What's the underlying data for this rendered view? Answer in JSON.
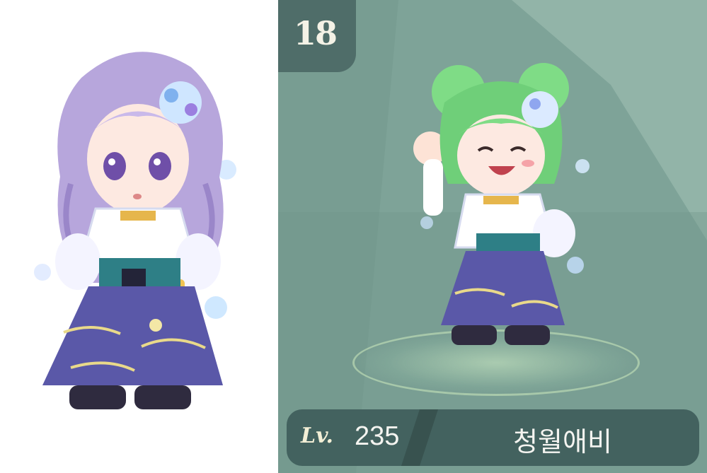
{
  "ranking_card": {
    "rank": "18",
    "level_label": "Lv.",
    "level_value": "235",
    "character_name": "청월애비"
  },
  "colors": {
    "card_background": "#7ea398",
    "badge_background": "#4f6d69",
    "name_bar_background": "#43625f",
    "left_character_hair": "#b7a6dc",
    "right_character_hair": "#7fdc86"
  },
  "icons": [
    "character-avatar-lavender",
    "character-avatar-green"
  ]
}
